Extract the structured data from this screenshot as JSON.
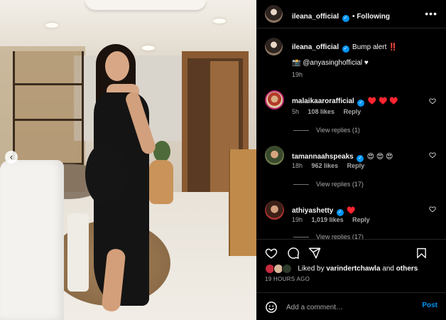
{
  "post": {
    "author": "ileana_official",
    "follow_label": "Following",
    "caption_text": "Bump alert ‼️",
    "caption_mention": "📸 @anyasinghofficial ♥",
    "caption_time": "19h"
  },
  "comments": [
    {
      "user": "malaikaarorafficial",
      "text": "♥️ ♥️ ♥️",
      "time": "5h",
      "likes": "108 likes",
      "reply": "Reply",
      "view_replies": "View replies (1)"
    },
    {
      "user": "tamannaahspeaks",
      "text": "😍 😍 😍",
      "time": "18h",
      "likes": "962 likes",
      "reply": "Reply",
      "view_replies": "View replies (17)"
    },
    {
      "user": "athiyashetty",
      "text": "♥️",
      "time": "19h",
      "likes": "1,019 likes",
      "reply": "Reply",
      "view_replies": "View replies (17)"
    }
  ],
  "likes_row": {
    "prefix": "Liked by",
    "user": "varindertchawla",
    "connector": "and",
    "others": "others"
  },
  "time_ago": "19 HOURS AGO",
  "add_comment": {
    "placeholder": "Add a comment…",
    "post_label": "Post"
  },
  "icons": [
    "heart-icon",
    "comment-icon",
    "share-icon",
    "bookmark-icon",
    "emoji-icon",
    "more-icon",
    "verified-icon",
    "chevron-left-icon"
  ],
  "colors": {
    "background": "#000000",
    "text": "#f5f5f5",
    "muted": "#a8a8a8",
    "accent": "#0095f6",
    "heart": "#ff3040"
  }
}
